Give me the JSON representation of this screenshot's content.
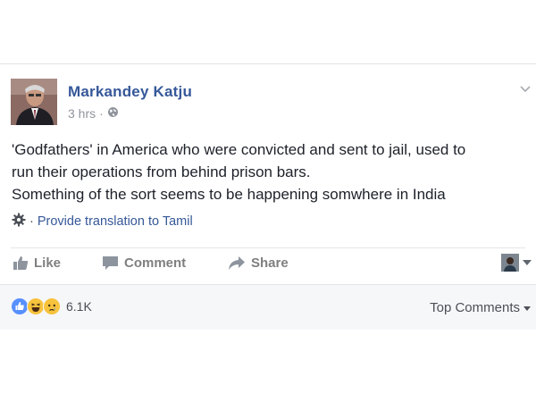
{
  "post": {
    "author": "Markandey Katju",
    "time": "3 hrs",
    "separator": "·",
    "privacy_icon": "globe-icon",
    "body_lines": [
      "'Godfathers' in America who were convicted and sent to jail, used to",
      "run their operations from behind prison bars.",
      "Something of the sort seems to be happening somwhere in India"
    ],
    "translation": {
      "icon": "gear-icon",
      "separator": "·",
      "link": "Provide translation to Tamil"
    }
  },
  "actions": {
    "like": "Like",
    "comment": "Comment",
    "share": "Share"
  },
  "footer": {
    "reaction_icons": [
      "like-reaction-icon",
      "haha-reaction-icon",
      "sad-reaction-icon"
    ],
    "reaction_count": "6.1K",
    "sort_label": "Top Comments"
  },
  "colors": {
    "author_link": "#365899",
    "action_gray": "#7f7f7f",
    "like_blue": "#5890ff",
    "reaction_yellow": "#f7c33d"
  }
}
